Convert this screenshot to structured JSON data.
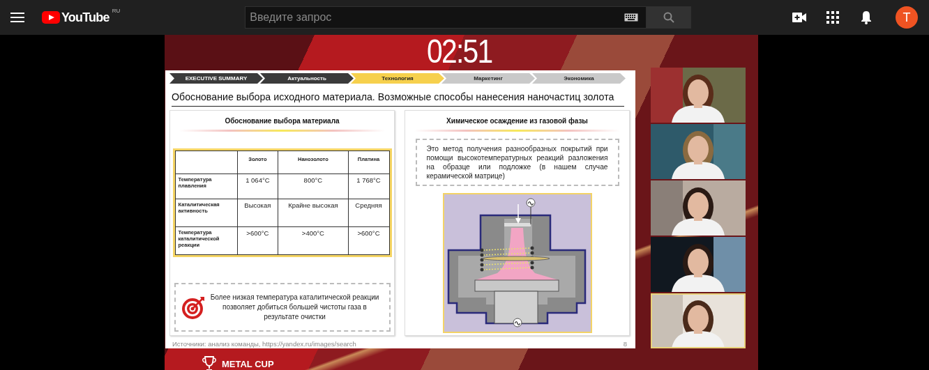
{
  "header": {
    "logo": {
      "text": "YouTube",
      "region": "RU"
    },
    "search": {
      "placeholder": "Введите запрос"
    },
    "avatar": {
      "letter": "T"
    }
  },
  "video": {
    "timer": "02:51",
    "slide": {
      "nav": [
        {
          "label": "EXECUTIVE SUMMARY",
          "selected": false,
          "visited": true
        },
        {
          "label": "Актуальность",
          "selected": false,
          "visited": true
        },
        {
          "label": "Технология",
          "selected": true,
          "visited": false
        },
        {
          "label": "Маркетинг",
          "selected": false,
          "visited": false
        },
        {
          "label": "Экономика",
          "selected": false,
          "visited": false
        }
      ],
      "title": "Обоснование выбора исходного материала. Возможные способы нанесения наночастиц золота",
      "left_panel": {
        "heading": "Обоснование выбора материала",
        "table": {
          "columns": [
            "Золото",
            "Нанозолото",
            "Платина"
          ],
          "rows": [
            {
              "label": "Температура плавления",
              "cells": [
                "1 064°C",
                "800°C",
                "1 768°C"
              ]
            },
            {
              "label": "Каталитическая активность",
              "cells": [
                "Высокая",
                "Крайне высокая",
                "Средняя"
              ]
            },
            {
              "label": "Температура каталитической реакции",
              "cells": [
                ">600°C",
                ">400°C",
                ">600°C"
              ]
            }
          ]
        },
        "note": "Более низкая температура каталитической реакции позволяет добиться большей чистоты газа в результате очистки"
      },
      "right_panel": {
        "heading": "Химическое осаждение из газовой фазы",
        "note": "Это метод получения разнообразных покрытий при помощи высокотемпературных реакций разложения на образце или подложке (в нашем случае керамической матрице)"
      },
      "sources": "Источники: анализ команды, https://yandex.ru/images/search",
      "page_number": "8"
    },
    "participants": [
      {
        "kind": "picture",
        "speaking": false
      },
      {
        "kind": "picture",
        "speaking": false
      },
      {
        "kind": "picture",
        "speaking": false
      },
      {
        "kind": "picture",
        "speaking": false
      },
      {
        "kind": "picture",
        "speaking": true
      }
    ],
    "brand": "METAL CUP"
  }
}
